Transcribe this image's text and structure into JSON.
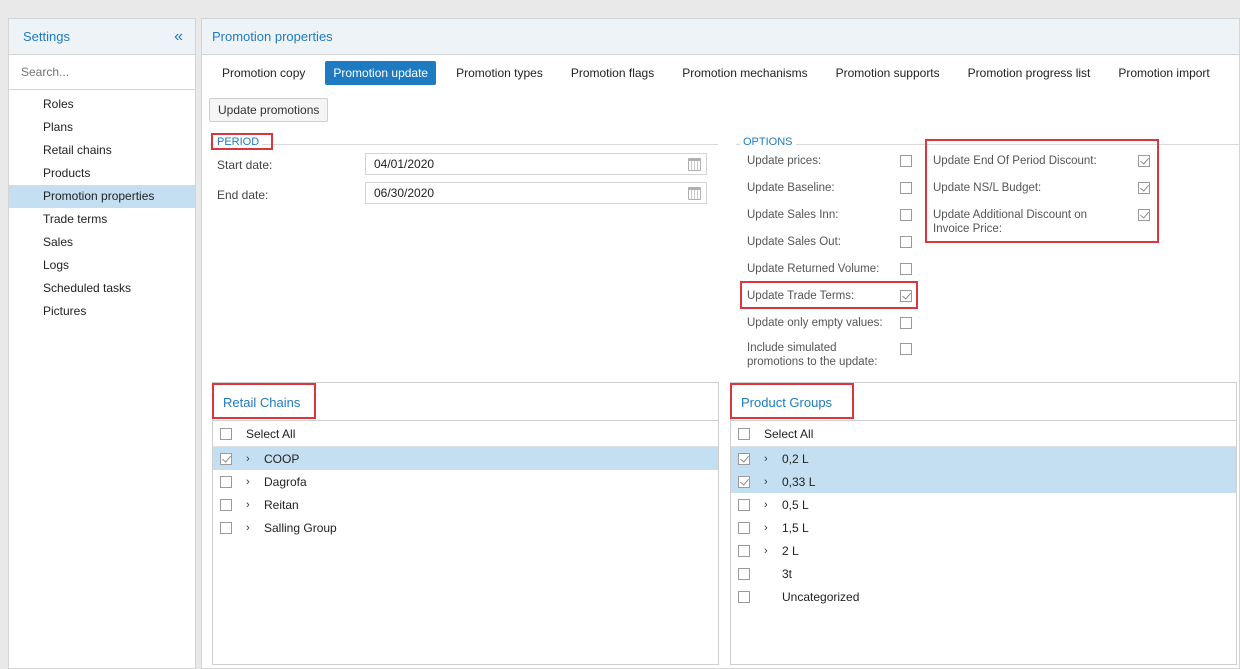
{
  "sidebar": {
    "title": "Settings",
    "collapse_icon": "«",
    "search_placeholder": "Search...",
    "items": [
      {
        "label": "Roles"
      },
      {
        "label": "Plans"
      },
      {
        "label": "Retail chains"
      },
      {
        "label": "Products"
      },
      {
        "label": "Promotion properties",
        "active": true
      },
      {
        "label": "Trade terms"
      },
      {
        "label": "Sales"
      },
      {
        "label": "Logs"
      },
      {
        "label": "Scheduled tasks"
      },
      {
        "label": "Pictures"
      }
    ]
  },
  "main": {
    "title": "Promotion properties",
    "tabs": [
      {
        "label": "Promotion copy"
      },
      {
        "label": "Promotion update",
        "active": true
      },
      {
        "label": "Promotion types"
      },
      {
        "label": "Promotion flags"
      },
      {
        "label": "Promotion mechanisms"
      },
      {
        "label": "Promotion supports"
      },
      {
        "label": "Promotion progress list"
      },
      {
        "label": "Promotion import"
      }
    ],
    "update_button": "Update promotions"
  },
  "period": {
    "label": "PERIOD",
    "start_label": "Start date:",
    "start_value": "04/01/2020",
    "end_label": "End date:",
    "end_value": "06/30/2020"
  },
  "options": {
    "label": "OPTIONS",
    "left": [
      {
        "label": "Update prices:",
        "checked": false
      },
      {
        "label": "Update Baseline:",
        "checked": false
      },
      {
        "label": "Update Sales Inn:",
        "checked": false
      },
      {
        "label": "Update Sales Out:",
        "checked": false
      },
      {
        "label": "Update Returned Volume:",
        "checked": false
      },
      {
        "label": "Update Trade Terms:",
        "checked": true
      },
      {
        "label": "Update only empty values:",
        "checked": false
      },
      {
        "label": "Include simulated promotions to the update:",
        "checked": false
      }
    ],
    "right": [
      {
        "label": "Update End Of Period Discount:",
        "checked": true
      },
      {
        "label": "Update NS/L Budget:",
        "checked": true
      },
      {
        "label": "Update Additional Discount on Invoice Price:",
        "checked": true
      }
    ]
  },
  "retail_chains": {
    "title": "Retail Chains",
    "select_all": "Select All",
    "items": [
      {
        "label": "COOP",
        "checked": true,
        "expandable": true
      },
      {
        "label": "Dagrofa",
        "checked": false,
        "expandable": true
      },
      {
        "label": "Reitan",
        "checked": false,
        "expandable": true
      },
      {
        "label": "Salling Group",
        "checked": false,
        "expandable": true
      }
    ]
  },
  "product_groups": {
    "title": "Product Groups",
    "select_all": "Select All",
    "items": [
      {
        "label": "0,2 L",
        "checked": true,
        "expandable": true
      },
      {
        "label": "0,33 L",
        "checked": true,
        "expandable": true
      },
      {
        "label": "0,5 L",
        "checked": false,
        "expandable": true
      },
      {
        "label": "1,5 L",
        "checked": false,
        "expandable": true
      },
      {
        "label": "2 L",
        "checked": false,
        "expandable": true
      },
      {
        "label": "3t",
        "checked": false,
        "expandable": false
      },
      {
        "label": "Uncategorized",
        "checked": false,
        "expandable": false
      }
    ]
  },
  "colors": {
    "accent": "#1f7bc1",
    "selected_row": "#c5dff2",
    "highlight_box": "#d9363e"
  },
  "icons": {
    "chevron_right": "›",
    "calendar": "calendar-icon"
  }
}
